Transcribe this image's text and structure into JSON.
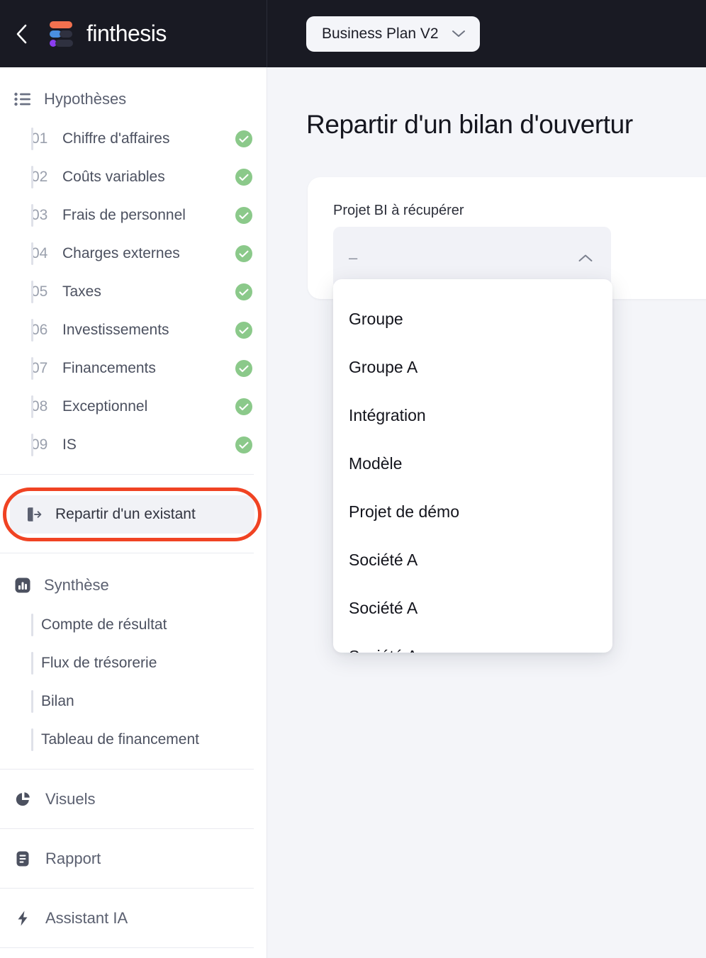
{
  "topbar": {
    "back_icon": "chevron-left-icon",
    "brand_name": "finthesis",
    "plan_selector": {
      "label": "Business Plan V2",
      "icon": "chevron-down-icon"
    }
  },
  "sidebar": {
    "hypotheses": {
      "icon": "list-icon",
      "title": "Hypothèses",
      "items": [
        {
          "num": "01",
          "label": "Chiffre d'affaires",
          "status": "check-icon"
        },
        {
          "num": "02",
          "label": "Coûts variables",
          "status": "check-icon"
        },
        {
          "num": "03",
          "label": "Frais de personnel",
          "status": "check-icon"
        },
        {
          "num": "04",
          "label": "Charges externes",
          "status": "check-icon"
        },
        {
          "num": "05",
          "label": "Taxes",
          "status": "check-icon"
        },
        {
          "num": "06",
          "label": "Investissements",
          "status": "check-icon"
        },
        {
          "num": "07",
          "label": "Financements",
          "status": "check-icon"
        },
        {
          "num": "08",
          "label": "Exceptionnel",
          "status": "check-icon"
        },
        {
          "num": "09",
          "label": "IS",
          "status": "check-icon"
        }
      ]
    },
    "highlighted": {
      "icon": "export-arrow-icon",
      "label": "Repartir d'un existant"
    },
    "synthese": {
      "icon": "bar-chart-icon",
      "title": "Synthèse",
      "items": [
        {
          "label": "Compte de résultat"
        },
        {
          "label": "Flux de trésorerie"
        },
        {
          "label": "Bilan"
        },
        {
          "label": "Tableau de financement"
        }
      ]
    },
    "sections": [
      {
        "icon": "pie-chart-icon",
        "label": "Visuels"
      },
      {
        "icon": "document-icon",
        "label": "Rapport"
      },
      {
        "icon": "lightning-bolt-icon",
        "label": "Assistant IA"
      }
    ]
  },
  "main": {
    "page_title": "Repartir d'un bilan d'ouvertur",
    "card": {
      "field_label": "Projet BI à récupérer",
      "select": {
        "value": "–",
        "icon": "chevron-up-icon"
      },
      "dropdown_options": [
        "Groupe",
        "Groupe A",
        "Intégration",
        "Modèle",
        "Projet de démo",
        "Société A",
        "Société A",
        "Société A"
      ]
    }
  },
  "colors": {
    "dark_header": "#191a23",
    "page_bg": "#f4f5f9",
    "highlight_ring": "#f04323",
    "status_green": "#8bc98a",
    "logo_orange": "#f2714f",
    "logo_blue": "#4a90e2",
    "logo_purple": "#8b3df0"
  }
}
